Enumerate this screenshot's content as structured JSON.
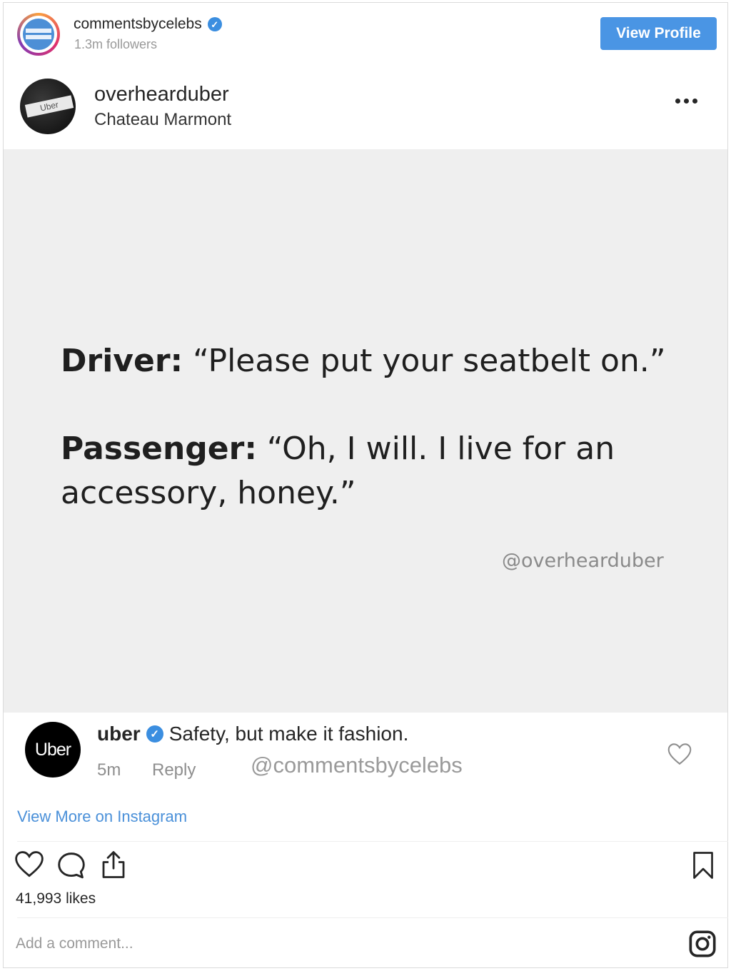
{
  "header": {
    "username": "commentsbycelebs",
    "followers": "1.3m followers",
    "view_profile_label": "View Profile"
  },
  "post": {
    "owner": "overhearduber",
    "location": "Chateau Marmont",
    "image_text": {
      "line1_speaker": "Driver:",
      "line1_quote": " “Please put your seatbelt on.”",
      "line2_speaker": "Passenger:",
      "line2_quote": " “Oh, I will. I live for an",
      "line3": "accessory, honey.”",
      "watermark": "@overhearduber"
    }
  },
  "comment": {
    "avatar_text": "Uber",
    "user": "uber",
    "text": "Safety, but make it fashion.",
    "time": "5m",
    "reply_label": "Reply",
    "watermark": "@commentsbycelebs"
  },
  "view_more_label": "View More on Instagram",
  "likes": "41,993 likes",
  "add_comment_placeholder": "Add a comment...",
  "icons": {
    "more": "more-options-icon",
    "heart": "heart-icon",
    "comment": "comment-icon",
    "share": "share-icon",
    "save": "bookmark-icon",
    "instagram": "instagram-icon",
    "verified": "verified-badge-icon"
  },
  "colors": {
    "accent": "#4a95e4",
    "link": "#4a90d9",
    "verified": "#3b8ee0",
    "post_bg": "#efefef"
  }
}
